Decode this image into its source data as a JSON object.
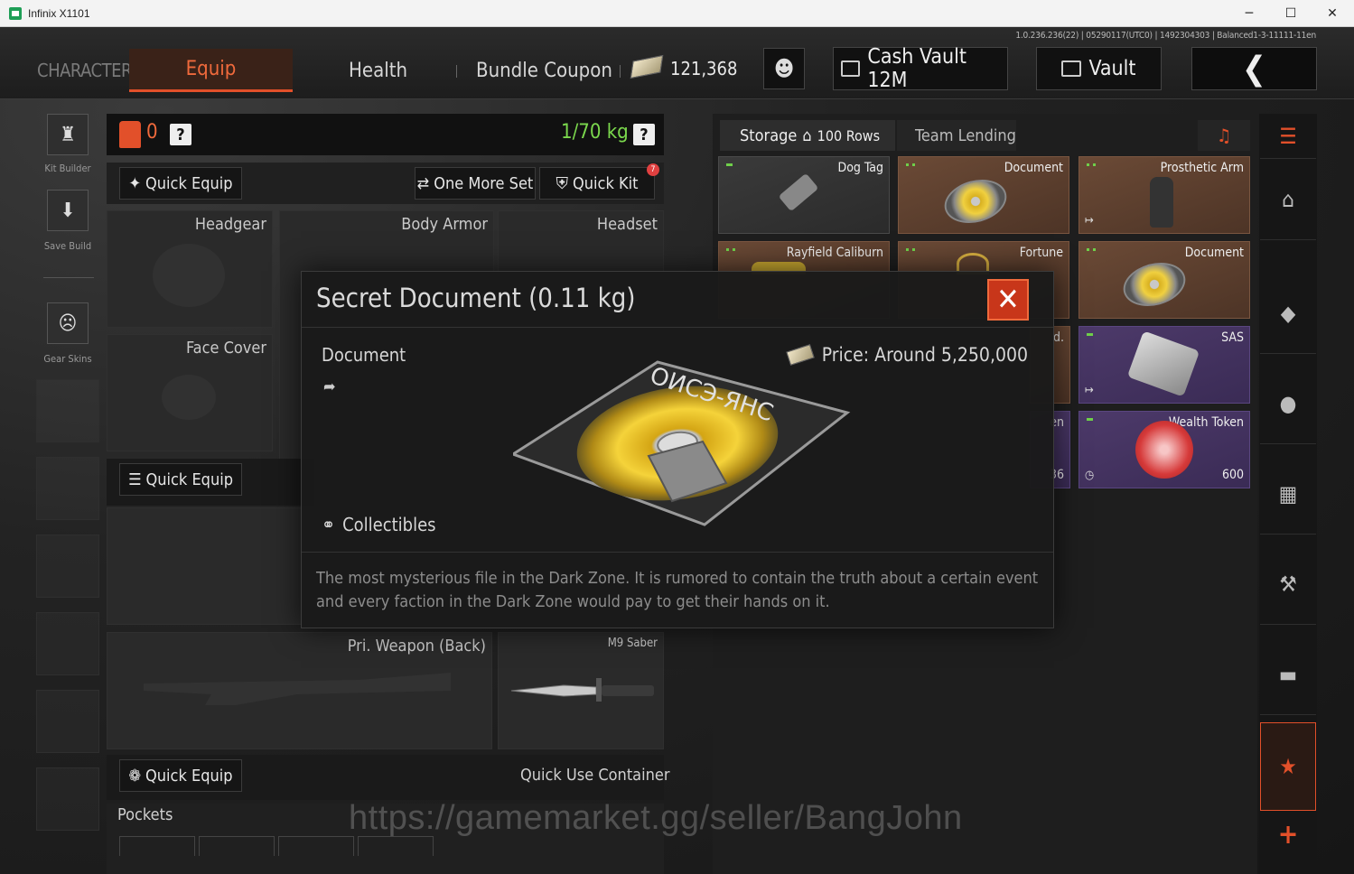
{
  "window": {
    "title": "Infinix X1101",
    "minimize": "─",
    "maximize": "☐",
    "close": "✕"
  },
  "server_info": "1.0.236.236(22) | 05290117(UTC0) | 1492304303 | Balanced1-3-11111-11en",
  "nav": {
    "character": "CHARACTER",
    "equip": "Equip",
    "health": "Health",
    "bundle_coupon": "Bundle Coupon",
    "cash_amount": "121,368",
    "cash_vault": "Cash Vault 12M",
    "vault": "Vault",
    "back": "❮"
  },
  "left_rail": {
    "kit_builder": "Kit Builder",
    "save_build": "Save Build",
    "gear_skins": "Gear Skins"
  },
  "equipment": {
    "bag_count": "0",
    "help": "?",
    "weight": "1/70 kg",
    "quick_equip_top": "Quick Equip",
    "one_more_set": "One More Set",
    "quick_kit": "Quick Kit",
    "quick_kit_badge": "7",
    "headgear": "Headgear",
    "body_armor": "Body Armor",
    "headset": "Headset",
    "face_cover": "Face Cover",
    "quick_equip_mid": "Quick Equip",
    "pri_weapon_back": "Pri. Weapon (Back)",
    "m9_saber": "M9 Saber",
    "quick_equip_bottom": "Quick Equip",
    "quick_use_container": "Quick Use Container",
    "pockets": "Pockets"
  },
  "storage": {
    "tab_storage": "Storage",
    "rows": "100 Rows",
    "tab_team_lending": "Team Lending",
    "items": [
      {
        "name": "Dog Tag",
        "rarity": "gray"
      },
      {
        "name": "Document",
        "rarity": "orange"
      },
      {
        "name": "Prosthetic Arm",
        "rarity": "orange"
      },
      {
        "name": "Rayfield Caliburn",
        "rarity": "orange"
      },
      {
        "name": "Fortune",
        "rarity": "orange"
      },
      {
        "name": "Document",
        "rarity": "orange"
      },
      {
        "name": "SAS",
        "rarity": "purple"
      },
      {
        "name": "Wealth Token",
        "rarity": "purple",
        "count": "600"
      }
    ],
    "partial_label_1": "d.",
    "partial_label_2": "en",
    "partial_count": "36"
  },
  "modal": {
    "title": "Secret Document (0.11 kg)",
    "type": "Document",
    "price": "Price: Around 5,250,000",
    "category": "Collectibles",
    "description": "The most mysterious file in the Dark Zone. It is rumored to contain the truth about a certain event and every faction in the Dark Zone would pay to get their hands on it.",
    "close": "✕",
    "disc_label": "ОИСЭ-ЯНС"
  },
  "watermark": "https://gamemarket.gg/seller/BangJohn",
  "colors": {
    "accent": "#e2502a",
    "weight_green": "#7bd84d",
    "rarity_orange": "#6b4a36",
    "rarity_purple": "#4d3a6a"
  }
}
